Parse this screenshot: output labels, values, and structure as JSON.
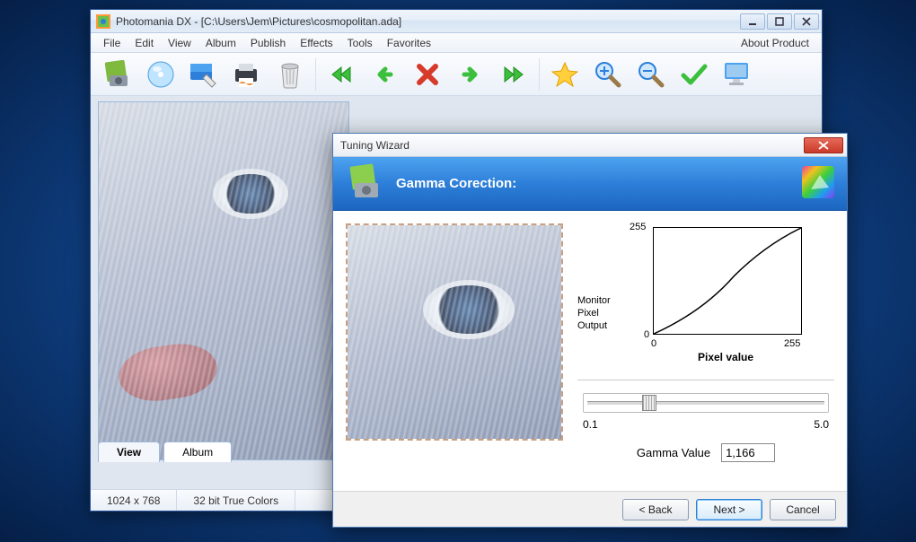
{
  "titlebar": {
    "text": "Photomania DX - [C:\\Users\\Jem\\Pictures\\cosmopolitan.ada]"
  },
  "menubar": {
    "items": [
      "File",
      "Edit",
      "View",
      "Album",
      "Publish",
      "Effects",
      "Tools",
      "Favorites"
    ],
    "right": "About Product"
  },
  "tabs": {
    "view": "View",
    "album": "Album"
  },
  "statusbar": {
    "dimensions": "1024 x 768",
    "color": "32 bit True Colors"
  },
  "dialog": {
    "title": "Tuning Wizard",
    "header": "Gamma Corection:",
    "y_axis_label_1": "Monitor",
    "y_axis_label_2": "Pixel",
    "y_axis_label_3": "Output",
    "x_axis_label": "Pixel value",
    "tick_255": "255",
    "tick_0": "0",
    "slider_min": "0.1",
    "slider_max": "5.0",
    "gamma_label": "Gamma Value",
    "gamma_value": "1,166",
    "btn_back": "< Back",
    "btn_next": "Next >",
    "btn_cancel": "Cancel"
  },
  "chart_data": {
    "type": "line",
    "title": "",
    "xlabel": "Pixel value",
    "ylabel": "Monitor Pixel Output",
    "xlim": [
      0,
      255
    ],
    "ylim": [
      0,
      255
    ],
    "x": [
      0,
      32,
      64,
      96,
      128,
      160,
      192,
      224,
      255
    ],
    "values": [
      0,
      22,
      50,
      82,
      118,
      156,
      196,
      226,
      255
    ]
  }
}
